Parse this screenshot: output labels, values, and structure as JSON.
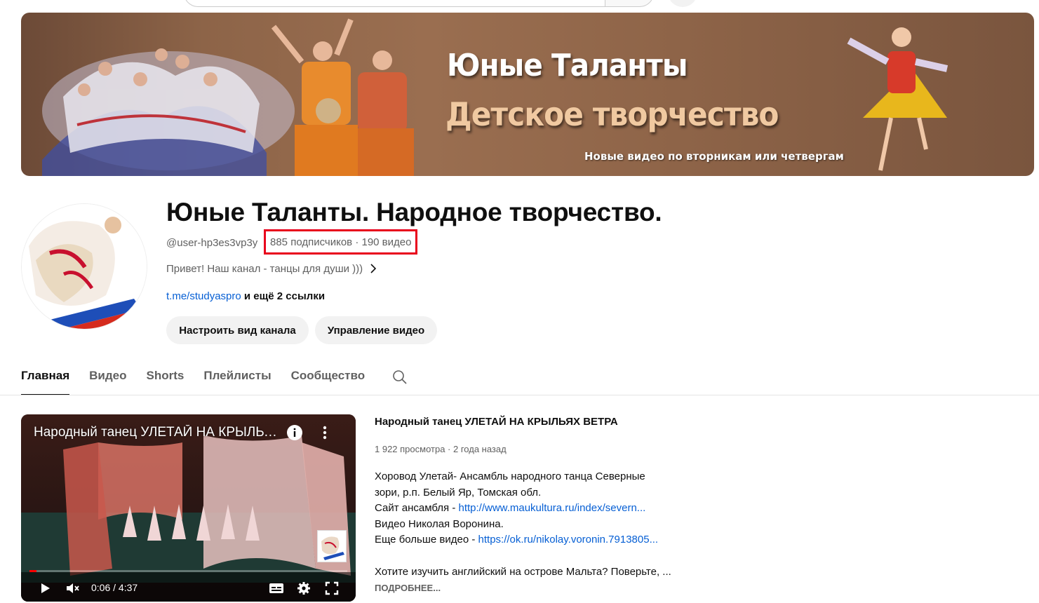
{
  "banner": {
    "title": "Юные Таланты",
    "subtitle": "Детское творчество",
    "note": "Новые видео по вторникам или четвергам"
  },
  "channel": {
    "name": "Юные Таланты. Народное творчество.",
    "handle": "@user-hp3es3vp3y",
    "stats": "885 подписчиков · 190 видео",
    "description": "Привет! Наш канал - танцы для души )))",
    "link": "t.me/studyaspro",
    "more_links": " и ещё 2 ссылки",
    "customize_label": "Настроить вид канала",
    "manage_label": "Управление видео"
  },
  "tabs": [
    {
      "label": "Главная",
      "active": true
    },
    {
      "label": "Видео",
      "active": false
    },
    {
      "label": "Shorts",
      "active": false
    },
    {
      "label": "Плейлисты",
      "active": false
    },
    {
      "label": "Сообщество",
      "active": false
    }
  ],
  "player": {
    "title": "Народный танец УЛЕТАЙ НА КРЫЛЬЯХ ВЕТРА",
    "time": "0:06 / 4:37",
    "progress": 0.022
  },
  "video": {
    "title": "Народный танец УЛЕТАЙ НА КРЫЛЬЯХ ВЕТРА",
    "meta": "1 922 просмотра · 2 года назад",
    "desc_line1": "Хоровод Улетай- Ансамбль народного танца Северные",
    "desc_line2": "зори, р.п. Белый Яр, Томская обл.",
    "desc_line3_prefix": "Сайт ансамбля -  ",
    "desc_line3_link": "http://www.maukultura.ru/index/severn...",
    "desc_line4": "Видео Николая Воронина.",
    "desc_line5_prefix": "Еще больше видео - ",
    "desc_line5_link": "https://ok.ru/nikolay.voronin.7913805...",
    "desc_line6": "Хотите изучить английский на острове Мальта?  Поверьте, ...",
    "more_label": "ПОДРОБНЕЕ..."
  },
  "colors": {
    "accent_red": "#e8001c",
    "link_blue": "#065fd4",
    "progress_red": "#ff0000"
  }
}
